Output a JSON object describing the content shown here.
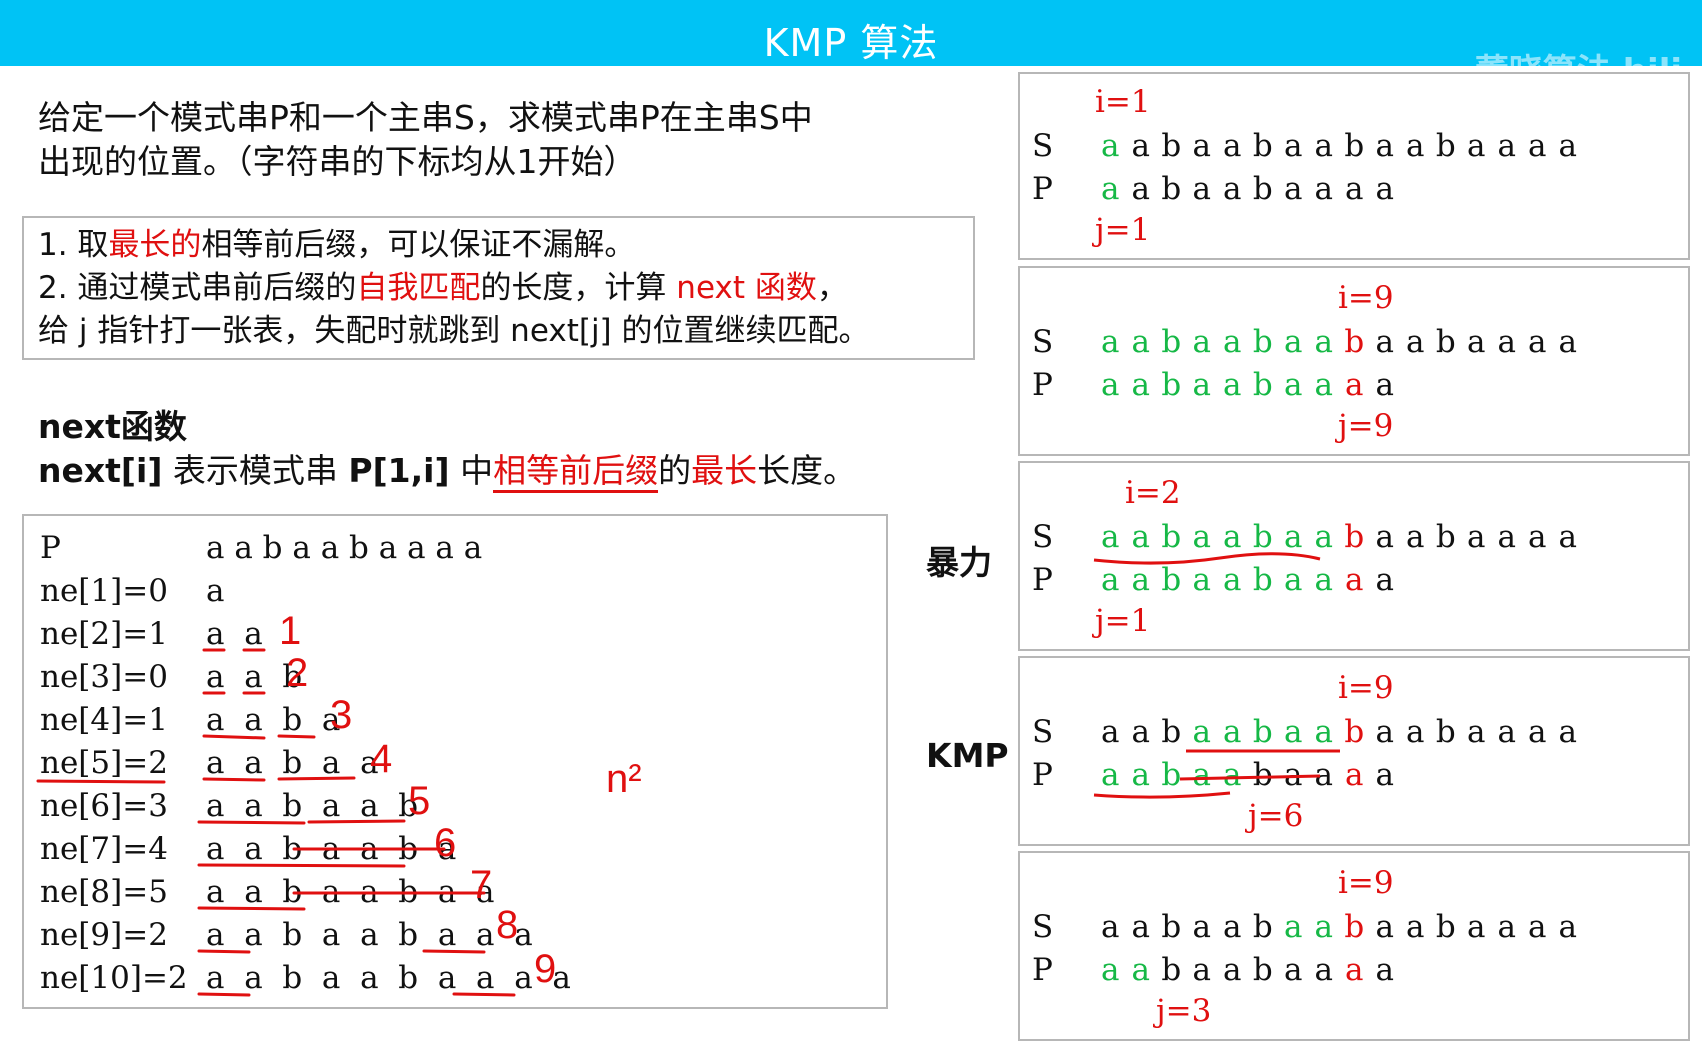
{
  "header": {
    "title": "KMP 算法",
    "watermark": "董晓算法 bili"
  },
  "problem": {
    "line1": "给定一个模式串P和一个主串S，求模式串P在主串S中",
    "line2": "出现的位置。（字符串的下标均从1开始）"
  },
  "tips": {
    "t1_a": "1. 取",
    "t1_b": "最长的",
    "t1_c": "相等前后缀，可以保证不漏解。",
    "t2_a": "2. 通过模式串前后缀的",
    "t2_b": "自我匹配",
    "t2_c": "的长度，计算 ",
    "t2_d": "next 函数",
    "t2_e": "，",
    "t3": "给 j 指针打一张表，失配时就跳到 next[j] 的位置继续匹配。"
  },
  "next_def": {
    "title": "next函数",
    "line_a": "next[i]",
    "line_b": " 表示模式串 ",
    "line_c": "P[1,i]",
    "line_d": " 中",
    "line_e": "相等前后缀",
    "line_f": "的",
    "line_g": "最长",
    "line_h": "长度。"
  },
  "table": {
    "rows": [
      {
        "label": "P",
        "value": "a a b a a b a a a a"
      },
      {
        "label": "ne[1]=0",
        "value": "a"
      },
      {
        "label": "ne[2]=1",
        "value": "a  a"
      },
      {
        "label": "ne[3]=0",
        "value": "a  a  b"
      },
      {
        "label": "ne[4]=1",
        "value": "a  a  b  a"
      },
      {
        "label": "ne[5]=2",
        "value": "a  a  b  a  a"
      },
      {
        "label": "ne[6]=3",
        "value": "a  a  b  a  a  b"
      },
      {
        "label": "ne[7]=4",
        "value": "a  a  b  a  a  b  a"
      },
      {
        "label": "ne[8]=5",
        "value": "a  a  b  a  a  b  a  a"
      },
      {
        "label": "ne[9]=2",
        "value": "a  a  b  a  a  b  a  a  a"
      },
      {
        "label": "ne[10]=2",
        "value": "a  a  b  a  a  b  a  a  a  a"
      }
    ],
    "hand_numbers": [
      "1",
      "2",
      "3",
      "4",
      "5",
      "6",
      "7",
      "8",
      "9"
    ],
    "hand_note": "n²"
  },
  "side_labels": {
    "brute": "暴力",
    "kmp": "KMP"
  },
  "panels": [
    {
      "i": "i=1",
      "j": "j=1",
      "S": "S",
      "P": "P",
      "s_seq": "aabaabaabaabaaaa",
      "p_seq": "aabaabaaaa"
    },
    {
      "i": "i=9",
      "j": "j=9",
      "S": "S",
      "P": "P",
      "s_seq": "aabaabaabaabaaaa",
      "p_seq": "aabaabaaaa"
    },
    {
      "i": "i=2",
      "j": "j=1",
      "S": "S",
      "P": "P",
      "s_seq": "aabaabaabaabaaaa",
      "p_seq": "aabaabaaaa"
    },
    {
      "i": "i=9",
      "j": "j=6",
      "S": "S",
      "P": "P",
      "s_seq": "aabaabaabaabaaaa",
      "p_seq": "aabaabaaaa"
    },
    {
      "i": "i=9",
      "j": "j=3",
      "S": "S",
      "P": "P",
      "s_seq": "aabaabaabaabaaaa",
      "p_seq": "aabaabaaaa"
    }
  ],
  "colors": {
    "header": "#00c3f5",
    "green": "#16b846",
    "red": "#e01010"
  }
}
